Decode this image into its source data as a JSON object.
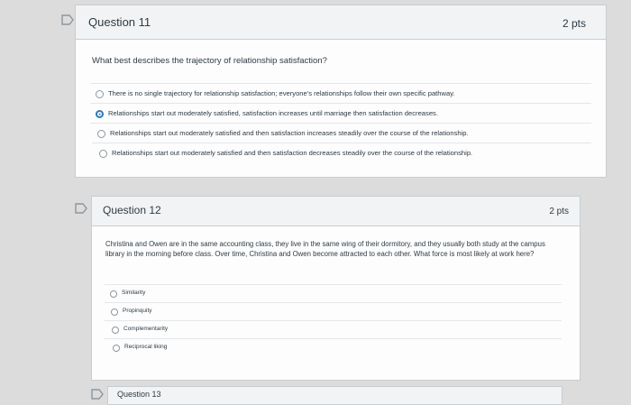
{
  "questions": [
    {
      "title": "Question 11",
      "points": "2 pts",
      "text": "What best describes the trajectory of relationship satisfaction?",
      "answers": [
        {
          "label": "There is no single trajectory for relationship satisfaction; everyone's relationships follow their own specific pathway.",
          "selected": false
        },
        {
          "label": "Relationships start out moderately satisfied, satisfaction increases until marriage then satisfaction decreases.",
          "selected": true
        },
        {
          "label": "Relationships start out moderately satisfied and then satisfaction increases steadily over the course of the relationship.",
          "selected": false
        },
        {
          "label": "Relationships start out moderately satisfied and then satisfaction decreases steadily over the course of the relationship.",
          "selected": false
        }
      ]
    },
    {
      "title": "Question 12",
      "points": "2 pts",
      "text": "Christina and Owen are in the same accounting class, they live in the same wing of their dormitory, and they usually both study at the campus library in the morning before class. Over time, Christina and Owen become attracted to each other. What force is most likely at work here?",
      "answers": [
        {
          "label": "Similarity",
          "selected": false
        },
        {
          "label": "Propinquity",
          "selected": false
        },
        {
          "label": "Complementarity",
          "selected": false
        },
        {
          "label": "Reciprocal liking",
          "selected": false
        }
      ]
    },
    {
      "title": "Question 13"
    }
  ],
  "icons": {
    "flag": "bookmark-flag-icon",
    "radio": "radio-button-icon"
  },
  "colors": {
    "selected": "#2b7abc",
    "background": "#dcdcdc",
    "card": "#fdfdfd",
    "header": "#f2f3f4"
  }
}
